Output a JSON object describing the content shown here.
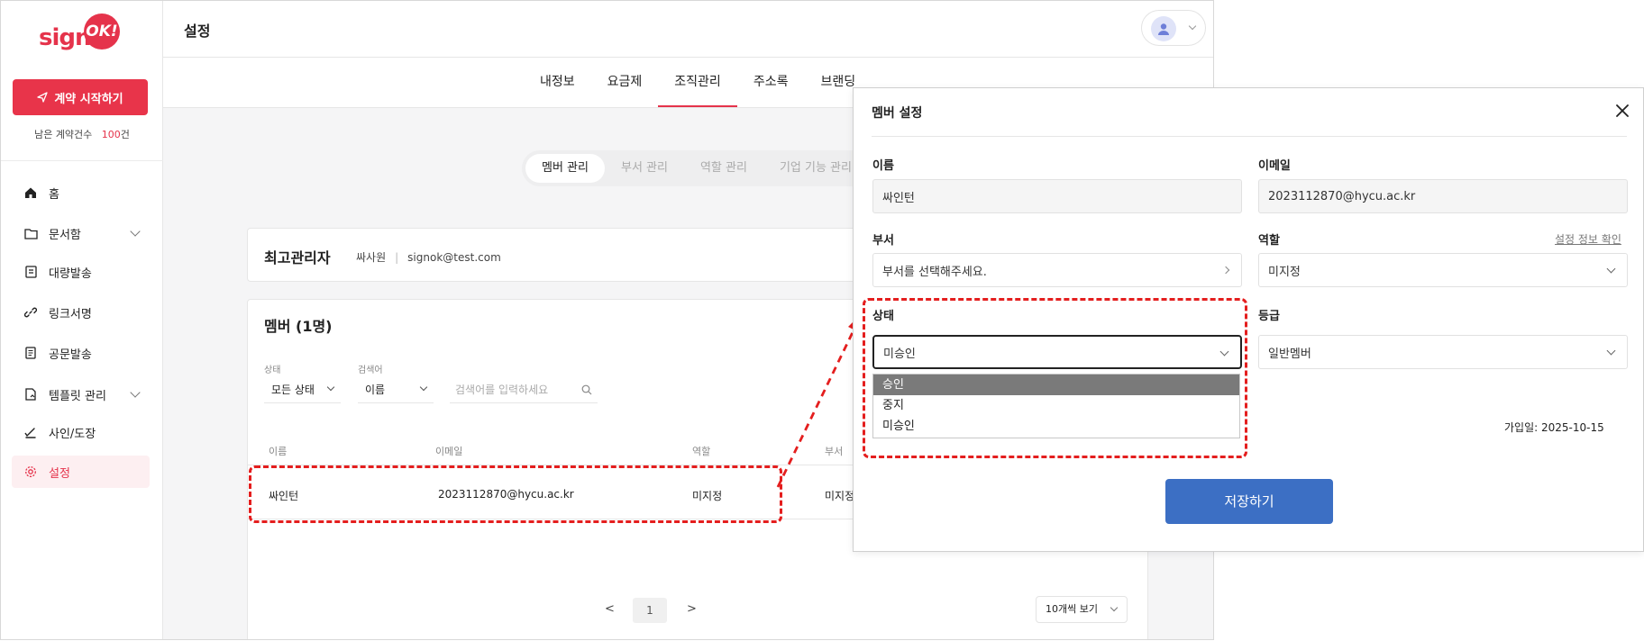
{
  "sidebar": {
    "logo_text": "sign",
    "logo_badge": "OK!",
    "start_button": "계약 시작하기",
    "remaining_label": "남은 계약건수",
    "remaining_count": "100",
    "remaining_unit": "건",
    "items": [
      {
        "label": "홈",
        "icon": "home-icon"
      },
      {
        "label": "문서함",
        "icon": "folder-icon"
      },
      {
        "label": "대량발송",
        "icon": "bulk-send-icon"
      },
      {
        "label": "링크서명",
        "icon": "link-icon"
      },
      {
        "label": "공문발송",
        "icon": "document-icon"
      },
      {
        "label": "템플릿 관리",
        "icon": "template-icon"
      },
      {
        "label": "사인/도장",
        "icon": "pen-icon"
      },
      {
        "label": "설정",
        "icon": "gear-icon"
      }
    ]
  },
  "header": {
    "title": "설정"
  },
  "tabs": [
    "내정보",
    "요금제",
    "조직관리",
    "주소록",
    "브랜딩"
  ],
  "subtabs": [
    "멤버 관리",
    "부서 관리",
    "역할 관리",
    "기업 기능 관리"
  ],
  "admin_card": {
    "title": "최고관리자",
    "name": "싸사원",
    "separator": "|",
    "email": "signok@test.com"
  },
  "members_card": {
    "title": "멤버 (1명)",
    "filter_status_label": "상태",
    "filter_status_value": "모든 상태",
    "filter_search_label": "검색어",
    "filter_search_field": "이름",
    "search_placeholder": "검색어를 입력하세요",
    "columns": [
      "이름",
      "이메일",
      "역할",
      "부서"
    ],
    "rows": [
      {
        "name": "싸인턴",
        "email": "2023112870@hycu.ac.kr",
        "role": "미지정",
        "dept": "미지정"
      }
    ],
    "pagination": {
      "prev": "<",
      "page": "1",
      "next": ">"
    },
    "per_page": "10개씩 보기"
  },
  "modal": {
    "title": "멤버 설정",
    "name_label": "이름",
    "name_value": "싸인턴",
    "email_label": "이메일",
    "email_value": "2023112870@hycu.ac.kr",
    "dept_label": "부서",
    "dept_placeholder": "부서를 선택해주세요.",
    "role_label": "역할",
    "role_link": "설정 정보 확인",
    "role_value": "미지정",
    "status_label": "상태",
    "status_value": "미승인",
    "status_options": [
      "승인",
      "중지",
      "미승인"
    ],
    "grade_label": "등급",
    "grade_value": "일반멤버",
    "joined": "가입일: 2025-10-15",
    "save_button": "저장하기"
  },
  "colors": {
    "brand_red": "#e5334b",
    "save_blue": "#3c6fc4",
    "highlight_red": "#e41e1e"
  }
}
